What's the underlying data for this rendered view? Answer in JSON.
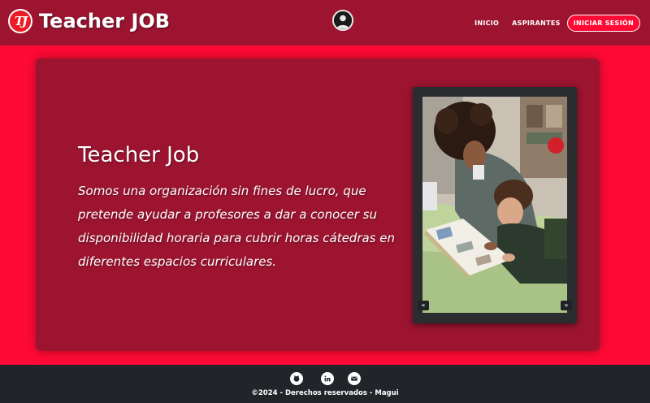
{
  "brand": {
    "logo_text": "TJ",
    "name": "Teacher JOB"
  },
  "nav": {
    "items": [
      {
        "label": "INICIO"
      },
      {
        "label": "ASPIRANTES"
      }
    ],
    "login_label": "INICIAR SESIÓN"
  },
  "hero": {
    "title": "Teacher Job",
    "description": "Somos una organización sin fines de lucro, que pretende ayudar a profesores a dar a conocer su disponibilidad horaria para cubrir horas cátedras en diferentes espacios curriculares."
  },
  "carousel": {
    "prev_label": "«",
    "next_label": "»"
  },
  "footer": {
    "socials": [
      {
        "icon": "github-icon"
      },
      {
        "icon": "linkedin-icon"
      },
      {
        "icon": "email-icon"
      }
    ],
    "copyright": "©2024 - Derechos reservados - Magui"
  },
  "colors": {
    "navbar": "#9c1430",
    "page_background": "#ff0a35",
    "hero_card": "#9c1430",
    "footer": "#212529",
    "logo": "#ea1b25"
  }
}
